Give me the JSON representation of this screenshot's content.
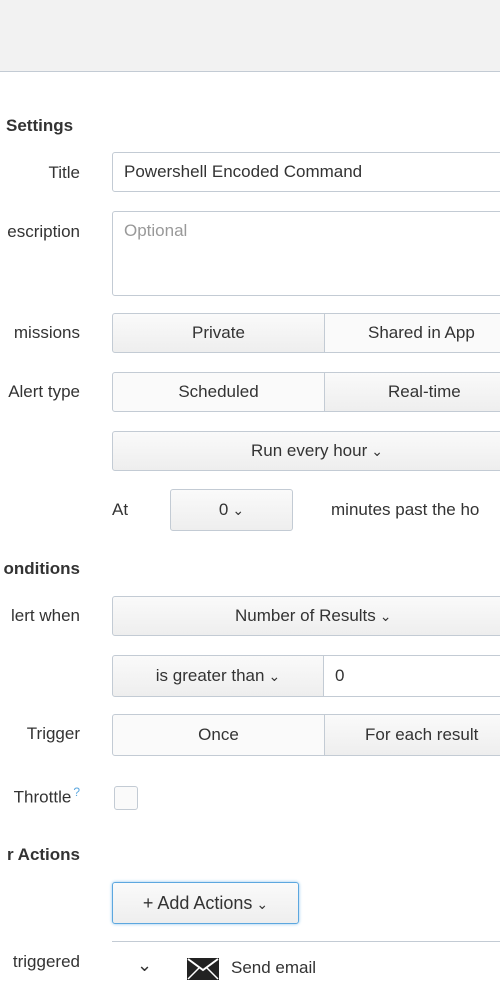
{
  "settings": {
    "section_label": "Settings",
    "title_label": "Title",
    "title_value": "Powershell Encoded Command",
    "description_label": "escription",
    "description_placeholder": "Optional",
    "permissions_label": "missions",
    "permissions_options": [
      "Private",
      "Shared in App"
    ],
    "alert_type_label": "Alert type",
    "alert_type_options": [
      "Scheduled",
      "Real-time"
    ],
    "schedule_value": "Run every hour",
    "at_label": "At",
    "minute_value": "0",
    "minutes_suffix": "minutes past the ho"
  },
  "conditions": {
    "section_label": "onditions",
    "alert_when_label": "lert when",
    "alert_when_value": "Number of Results",
    "comparator_value": "is greater than",
    "threshold_value": "0",
    "trigger_label": "Trigger",
    "trigger_options": [
      "Once",
      "For each result"
    ],
    "throttle_label": "Throttle",
    "throttle_help": "?"
  },
  "actions": {
    "section_label": "r Actions",
    "add_actions_label": "+ Add Actions",
    "triggered_label": "triggered",
    "items": [
      {
        "label": "Send email",
        "icon": "envelope-icon"
      }
    ]
  },
  "colors": {
    "border": "#c3cbd4",
    "focus_blue": "#5ca7df",
    "topbar": "#f2f2f2"
  }
}
